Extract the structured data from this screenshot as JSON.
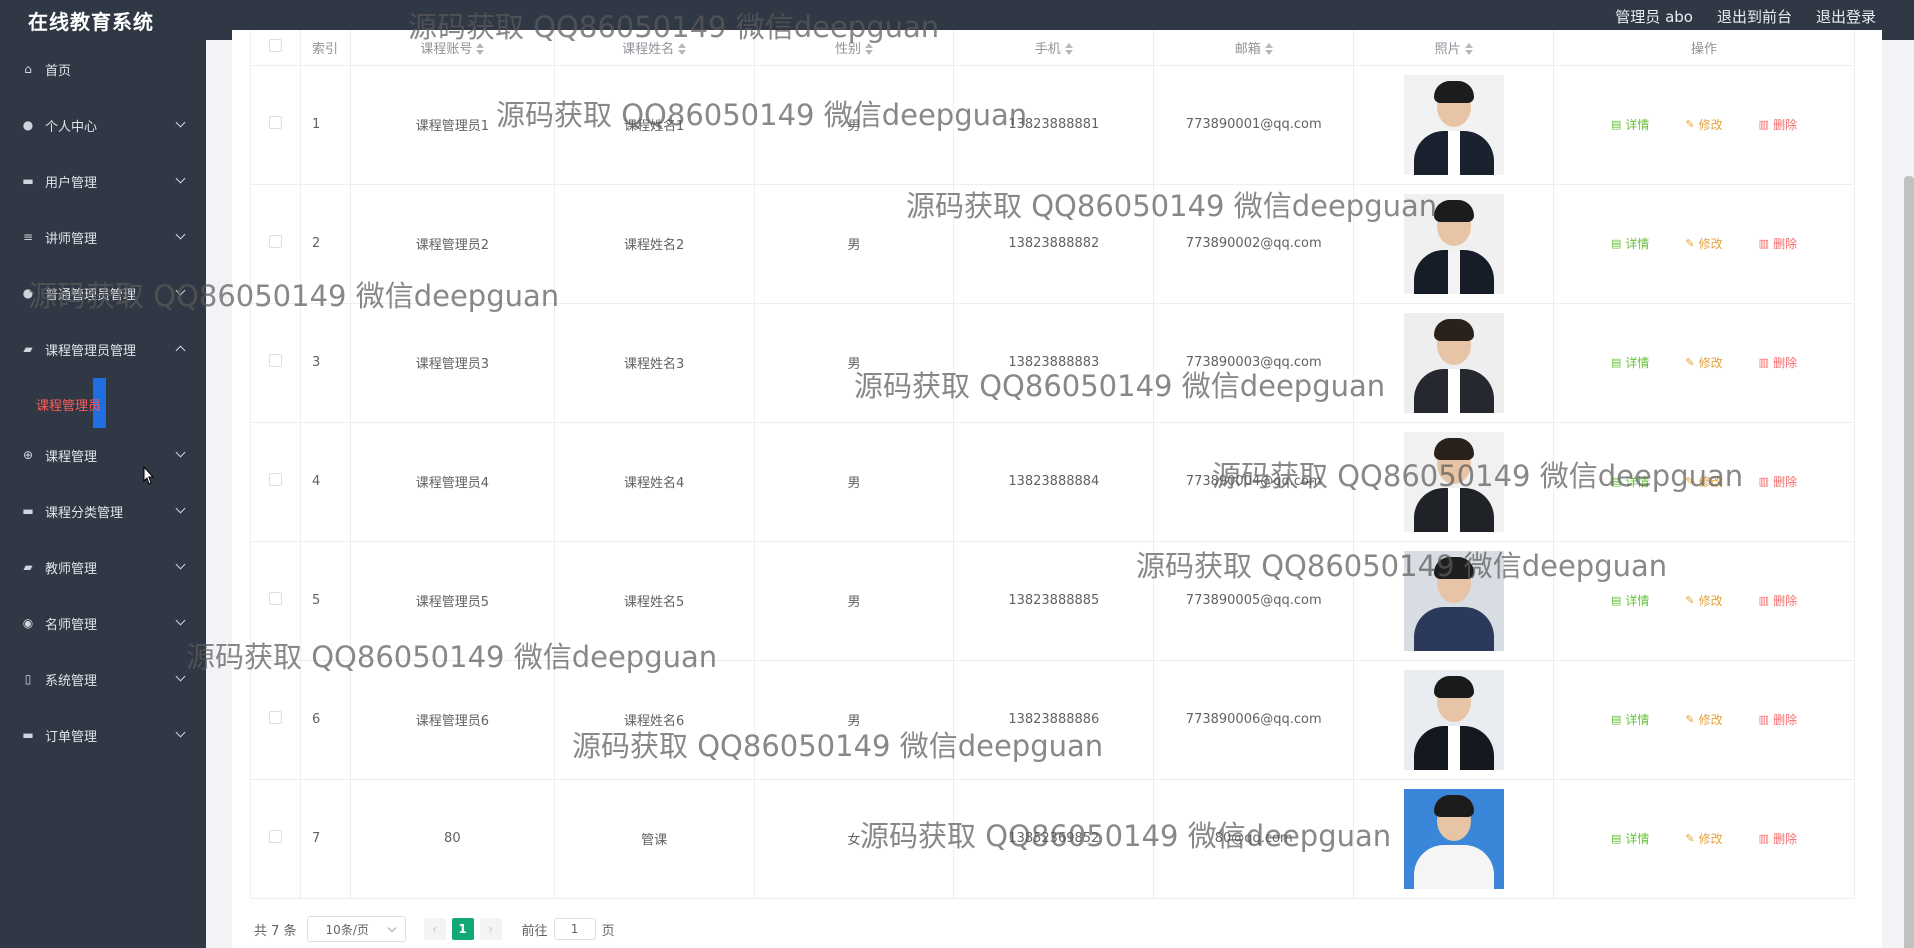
{
  "app": {
    "title": "在线教育系统"
  },
  "header": {
    "user": "管理员 abo",
    "front": "退出到前台",
    "logout": "退出登录"
  },
  "sidebar": {
    "items": [
      {
        "label": "首页",
        "icon": "home-icon"
      },
      {
        "label": "个人中心",
        "icon": "user-icon"
      },
      {
        "label": "用户管理",
        "icon": "chat-icon"
      },
      {
        "label": "讲师管理",
        "icon": "menu-icon"
      },
      {
        "label": "普通管理员管理",
        "icon": "bulb-icon"
      },
      {
        "label": "课程管理员管理",
        "icon": "briefcase-icon"
      },
      {
        "label": "课程管理",
        "icon": "compass-icon"
      },
      {
        "label": "课程分类管理",
        "icon": "ticket-icon"
      },
      {
        "label": "教师管理",
        "icon": "camera-icon"
      },
      {
        "label": "名师管理",
        "icon": "eye-icon"
      },
      {
        "label": "系统管理",
        "icon": "phone-icon"
      },
      {
        "label": "订单管理",
        "icon": "plug-icon"
      }
    ],
    "active_sub": "课程管理员"
  },
  "table": {
    "headers": [
      "索引",
      "课程账号",
      "课程姓名",
      "性别",
      "手机",
      "邮箱",
      "照片",
      "操作"
    ],
    "rows": [
      {
        "index": "1",
        "account": "课程管理员1",
        "name": "课程姓名1",
        "gender": "男",
        "phone": "13823888881",
        "email": "773890001@qq.com"
      },
      {
        "index": "2",
        "account": "课程管理员2",
        "name": "课程姓名2",
        "gender": "男",
        "phone": "13823888882",
        "email": "773890002@qq.com"
      },
      {
        "index": "3",
        "account": "课程管理员3",
        "name": "课程姓名3",
        "gender": "男",
        "phone": "13823888883",
        "email": "773890003@qq.com"
      },
      {
        "index": "4",
        "account": "课程管理员4",
        "name": "课程姓名4",
        "gender": "男",
        "phone": "13823888884",
        "email": "773890004@qq.com"
      },
      {
        "index": "5",
        "account": "课程管理员5",
        "name": "课程姓名5",
        "gender": "男",
        "phone": "13823888885",
        "email": "773890005@qq.com"
      },
      {
        "index": "6",
        "account": "课程管理员6",
        "name": "课程姓名6",
        "gender": "男",
        "phone": "13823888886",
        "email": "773890006@qq.com"
      },
      {
        "index": "7",
        "account": "80",
        "name": "管课",
        "gender": "女",
        "phone": "13852369852",
        "email": "80@qq.com"
      }
    ],
    "ops": {
      "detail": "详情",
      "edit": "修改",
      "delete": "删除"
    }
  },
  "pager": {
    "total": "共 7 条",
    "size": "10条/页",
    "current": "1",
    "goto": "前往",
    "goto_value": "1",
    "page_unit": "页"
  },
  "watermark": "源码获取 QQ86050149 微信deepguan"
}
